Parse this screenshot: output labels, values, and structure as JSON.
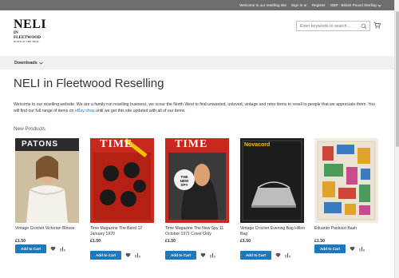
{
  "header": {
    "welcome": "Welcome to our reselling site",
    "sign_in": "Sign In",
    "or": "or",
    "register": "Register",
    "currency": "GBP - British Pound Sterling"
  },
  "logo": {
    "line1": "NELI",
    "line2": "IN FLEETWOOD",
    "line3": "DOWN AT THE SHOP"
  },
  "search": {
    "placeholder": "Enter keywords to search..."
  },
  "nav": {
    "downloads": "Downloads"
  },
  "page": {
    "title": "NELI in Fleetwood Reselling",
    "intro_before_link": "Welcome to our reselling website. We are a family run reselling business, we scour the North West to find unwanted, unloved, vintage and retro items to resell to people that we appreciate them. You will find our full range of items on ",
    "intro_link": "eBay shop",
    "intro_after_link": " until we get this site updated with all of our items.",
    "section_title": "New Products"
  },
  "products": [
    {
      "name": "Vintage Crochet Victorian Blouse",
      "price": "£1.50",
      "add_to_cart": "Add to Cart",
      "cover_text": "PATONS"
    },
    {
      "name": "Time Magazine The Band 12 January 1970",
      "price": "£1.50",
      "add_to_cart": "Add to Cart",
      "cover_text": "TIME"
    },
    {
      "name": "Time Magazine The New Spy 11 October 1971 Cover Only",
      "price": "£1.50",
      "add_to_cart": "Add to Cart",
      "cover_text": "TIME",
      "cover_sub": "THE NEW SPY"
    },
    {
      "name": "Vintage Crochet Evening Bag Hilton Bag",
      "price": "£1.50",
      "add_to_cart": "Add to Cart",
      "cover_text": "Novacord"
    },
    {
      "name": "Eduardo Paolozzi Bash",
      "price": "£1.50",
      "add_to_cart": "Add to Cart"
    }
  ],
  "colors": {
    "topbar": "#6e6e6e",
    "accent": "#1979c3",
    "nav_bg": "#f0f0f0"
  },
  "icons": [
    "search-icon",
    "cart-icon",
    "chevron-down-icon",
    "heart-icon",
    "compare-icon"
  ]
}
